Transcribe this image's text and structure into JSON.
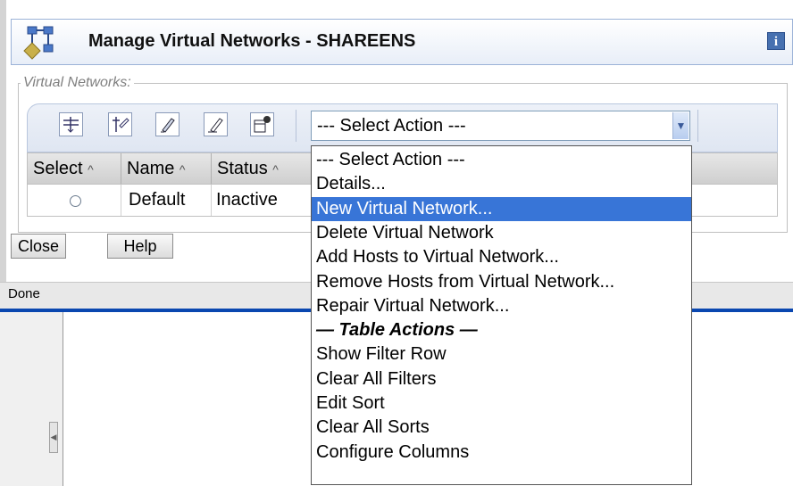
{
  "window": {
    "title": "Manage Virtual Networks - SHAREENS",
    "info_icon": "i"
  },
  "section": {
    "legend": "Virtual Networks:"
  },
  "toolbar": {
    "icons": [
      "filter-icon",
      "filter-clear-icon",
      "edit-icon",
      "clear-edit-icon",
      "configure-columns-icon"
    ],
    "select_value": "--- Select Action ---"
  },
  "table": {
    "columns": [
      "Select",
      "Name",
      "Status"
    ],
    "sort_glyph": "^",
    "rows": [
      {
        "name": "Default",
        "status": "Inactive"
      }
    ]
  },
  "buttons": {
    "close": "Close",
    "help": "Help"
  },
  "statusbar": {
    "text": "Done"
  },
  "dropdown": {
    "items": [
      "--- Select Action ---",
      "Details...",
      "New Virtual Network...",
      "Delete Virtual Network",
      "Add Hosts to Virtual Network...",
      "Remove Hosts from Virtual Network...",
      "Repair Virtual Network...",
      "— Table Actions —",
      "Show Filter Row",
      "Clear All Filters",
      "Edit Sort",
      "Clear All Sorts",
      "Configure Columns"
    ],
    "selected_index": 2,
    "header_index": 7
  },
  "colors": {
    "highlight": "#3875d7",
    "divider": "#0a47b0"
  }
}
